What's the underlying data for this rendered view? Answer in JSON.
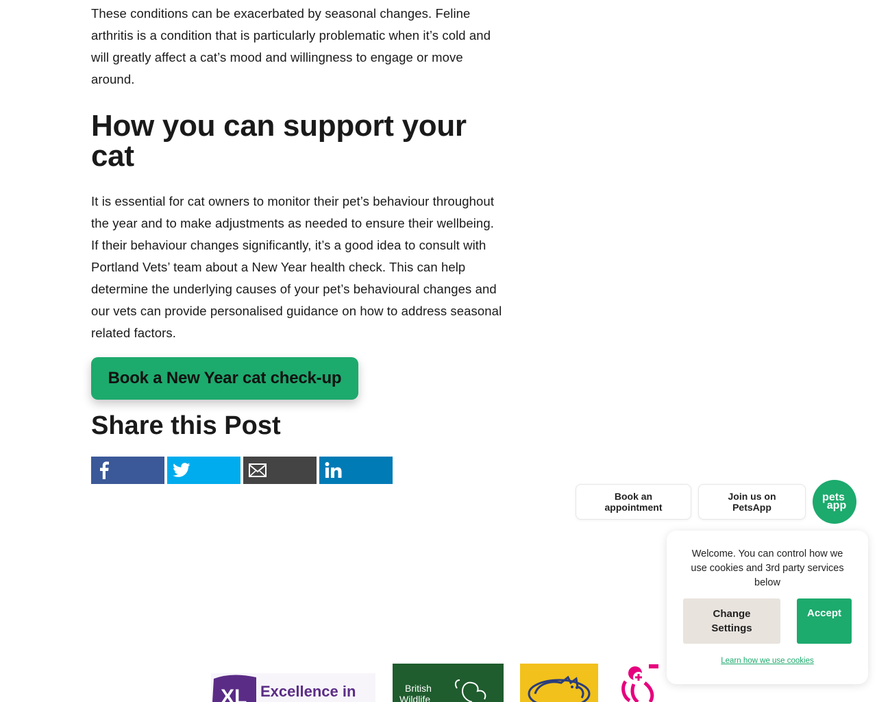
{
  "article": {
    "para1": "These conditions can be exacerbated by seasonal changes. Feline arthritis is a condition that is particularly problematic when it’s cold and will greatly affect a cat’s mood and willingness to engage or move around.",
    "heading": "How you can support your cat",
    "para2": "It is essential for cat owners to monitor their pet’s behaviour throughout the year and to make adjustments as needed to ensure their wellbeing. If their behaviour changes significantly, it’s a good idea to consult with Portland Vets’ team about a New Year health check. This can help determine the underlying causes of your pet’s behavioural changes and our vets can provide personalised guidance on how to address seasonal related factors."
  },
  "cta": {
    "label": "Book a New Year cat check-up"
  },
  "share": {
    "title": "Share this Post",
    "buttons": [
      {
        "network": "facebook",
        "icon": "facebook-icon",
        "color": "#3b5998"
      },
      {
        "network": "twitter",
        "icon": "twitter-icon",
        "color": "#00aced"
      },
      {
        "network": "email",
        "icon": "email-icon",
        "color": "#444444"
      },
      {
        "network": "linkedin",
        "icon": "linkedin-icon",
        "color": "#007bb6"
      }
    ]
  },
  "floating": {
    "book_line1": "Book an",
    "book_line2": "appointment",
    "join_line1": "Join us on",
    "join_line2": "PetsApp",
    "badge_line1": "pets",
    "badge_line2": "app"
  },
  "cookie": {
    "message": "Welcome. You can control how we use cookies and 3rd party services below",
    "change_line1": "Change",
    "change_line2": "Settings",
    "accept": "Accept",
    "learn": "Learn how we use cookies"
  },
  "logos": {
    "xl_mark": "XL",
    "xl_text": "Excellence in",
    "wildlife_line1": "British",
    "wildlife_line2": "Wildlife"
  },
  "colors": {
    "accent": "#1daa6d",
    "cookie_secondary": "#e8e3dd",
    "xl_purple": "#5b2c86",
    "wildlife_green": "#1f5c2e",
    "cat_yellow": "#f2c11b",
    "pink": "#e6007e"
  }
}
